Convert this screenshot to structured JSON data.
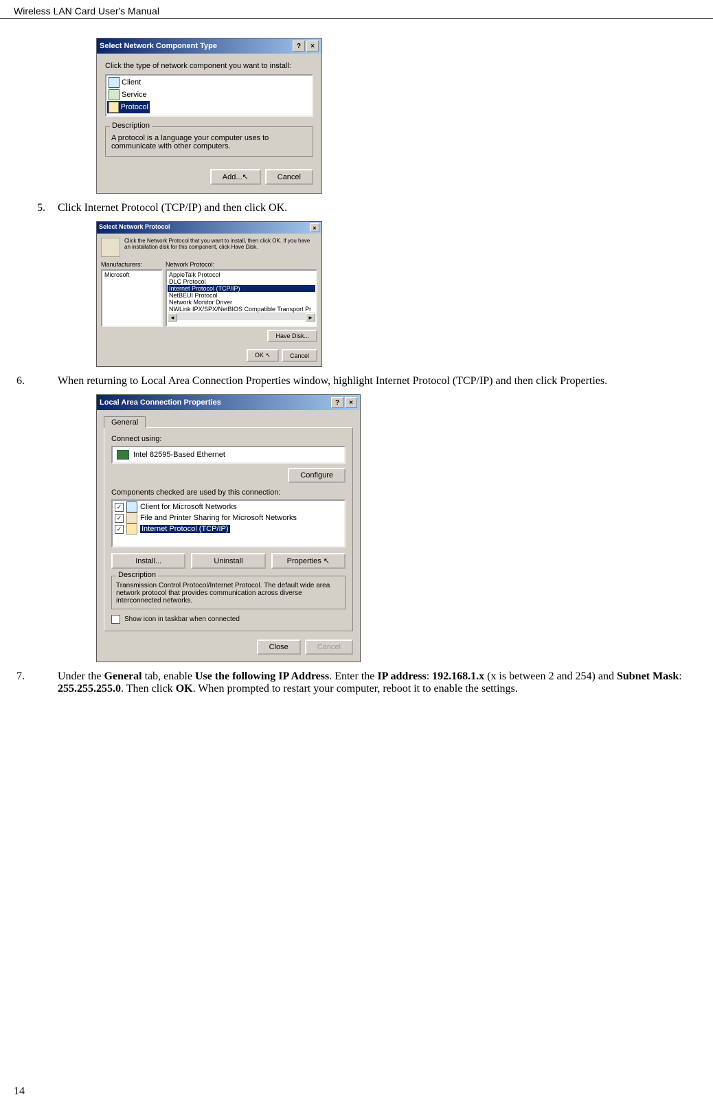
{
  "header": {
    "title": "Wireless LAN Card User's Manual"
  },
  "page_number": "14",
  "steps": {
    "s5": {
      "num": "5.",
      "text": "Click Internet Protocol (TCP/IP) and then click OK."
    },
    "s6": {
      "num": "6.",
      "text": "When returning to Local Area Connection Properties window, highlight Internet Protocol (TCP/IP) and then click Properties."
    },
    "s7": {
      "num": "7.",
      "pre": "Under the ",
      "b1": "General",
      "mid1": " tab, enable ",
      "b2": "Use the following IP Address",
      "mid2": ". Enter the ",
      "b3": "IP address",
      "mid3": ": ",
      "b4": "192.168.1.x",
      "mid4": " (x is between 2 and 254) and ",
      "b5": "Subnet Mask",
      "mid5": ": ",
      "b6": "255.255.255.0",
      "mid6": ". Then click ",
      "b7": "OK",
      "mid7": ". When prompted to restart your computer, reboot it to enable the settings."
    }
  },
  "dialog1": {
    "title": "Select Network Component Type",
    "help": "?",
    "close": "×",
    "prompt": "Click the type of network component you want to install:",
    "items": {
      "client": "Client",
      "service": "Service",
      "protocol": "Protocol"
    },
    "desc_legend": "Description",
    "desc_text": "A protocol is a language your computer uses to communicate with other computers.",
    "add": "Add...",
    "cancel": "Cancel"
  },
  "dialog2": {
    "title": "Select Network Protocol",
    "close": "×",
    "prompt": "Click the Network Protocol that you want to install, then click OK. If you have an installation disk for this component, click Have Disk.",
    "manu_label": "Manufacturers:",
    "proto_label": "Network Protocol:",
    "manu_item": "Microsoft",
    "protos": {
      "p1": "AppleTalk Protocol",
      "p2": "DLC Protocol",
      "p3": "Internet Protocol (TCP/IP)",
      "p4": "NetBEUI Protocol",
      "p5": "Network Monitor Driver",
      "p6": "NWLink IPX/SPX/NetBIOS Compatible Transport Pr"
    },
    "have_disk": "Have Disk...",
    "ok": "OK",
    "cancel": "Cancel"
  },
  "dialog3": {
    "title": "Local Area Connection Properties",
    "help": "?",
    "close": "×",
    "tab": "General",
    "connect_using": "Connect using:",
    "adapter": "Intel 82595-Based Ethernet",
    "configure": "Configure",
    "comp_label": "Components checked are used by this connection:",
    "comps": {
      "c1": "Client for Microsoft Networks",
      "c2": "File and Printer Sharing for Microsoft Networks",
      "c3": "Internet Protocol (TCP/IP)"
    },
    "install": "Install...",
    "uninstall": "Uninstall",
    "properties": "Properties",
    "desc_legend": "Description",
    "desc_text": "Transmission Control Protocol/Internet Protocol. The default wide area network protocol that provides communication across diverse interconnected networks.",
    "show_icon": "Show icon in taskbar when connected",
    "close_btn": "Close",
    "cancel_btn": "Cancel"
  }
}
